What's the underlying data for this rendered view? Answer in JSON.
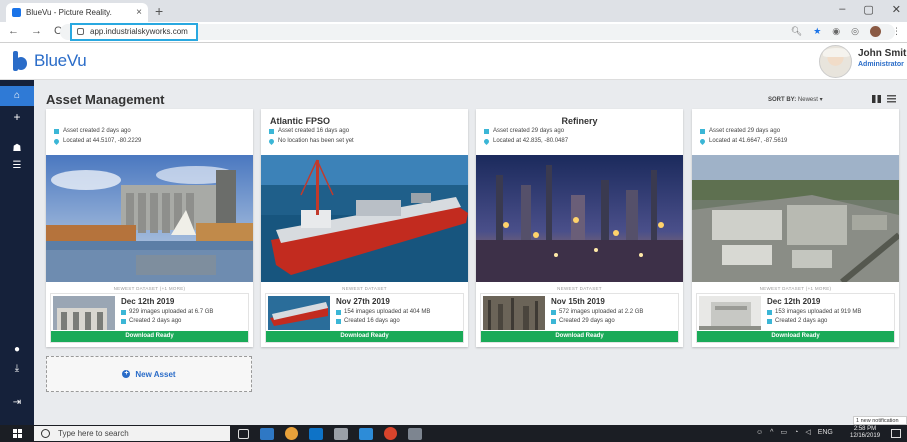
{
  "browser": {
    "tab_title": "BlueVu - Picture Reality.",
    "tab_close": "×",
    "new_tab": "+",
    "url": "app.industrialskyworks.com",
    "nav_back": "←",
    "nav_forward": "→",
    "nav_reload": "C",
    "win_minimize": "–",
    "win_maximize": "▢",
    "win_close": "✕"
  },
  "header": {
    "logo_text": "BlueVu",
    "user_name": "John Smith",
    "user_role": "Administrator"
  },
  "sidebar": {
    "icons": [
      "home-icon",
      "plus-icon",
      "hierarchy-icon",
      "list-icon",
      "person-icon",
      "download-icon",
      "logout-icon"
    ]
  },
  "main": {
    "title": "Asset Management",
    "sort_label": "SORT BY:",
    "sort_value": "Newest ▾",
    "dataset_label": "NEWEST DATASET (+1 MORE)",
    "dataset_label_single": "NEWEST DATASET",
    "new_asset_label": "New Asset"
  },
  "cards": [
    {
      "title": "",
      "created": "Asset created 2 days ago",
      "location": "Located at 44.5107, -80.2229",
      "dataset_label": "NEWEST DATASET (+1 MORE)",
      "ds_date": "Dec 12th 2019",
      "ds_images": "929 images uploaded at 6.7 GB",
      "ds_created": "Created 2 days ago",
      "ds_status": "Download Ready"
    },
    {
      "title": "Atlantic FPSO",
      "created": "Asset created 16 days ago",
      "location": "No location has been set yet",
      "dataset_label": "NEWEST DATASET",
      "ds_date": "Nov 27th 2019",
      "ds_images": "154 images uploaded at 404 MB",
      "ds_created": "Created 16 days ago",
      "ds_status": "Download Ready"
    },
    {
      "title": "Refinery",
      "created": "Asset created 29 days ago",
      "location": "Located at 42.835, -80.0487",
      "dataset_label": "NEWEST DATASET",
      "ds_date": "Nov 15th 2019",
      "ds_images": "572 images uploaded at 2.2 GB",
      "ds_created": "Created 29 days ago",
      "ds_status": "Download Ready"
    },
    {
      "title": "",
      "created": "Asset created 29 days ago",
      "location": "Located at 41.6647, -87.5619",
      "dataset_label": "NEWEST DATASET (+1 MORE)",
      "ds_date": "Dec 12th 2019",
      "ds_images": "153 images uploaded at 919 MB",
      "ds_created": "Created 2 days ago",
      "ds_status": "Download Ready"
    }
  ],
  "notification": "1 new notification",
  "taskbar": {
    "search_placeholder": "Type here to search",
    "tray_lang": "ENG",
    "time": "2:58 PM",
    "date": "12/16/2019"
  },
  "colors": {
    "brand_blue": "#2a6cc8",
    "sidebar_bg": "#15213a",
    "download_green": "#1aaa58",
    "meta_icon": "#3bb6d6"
  }
}
